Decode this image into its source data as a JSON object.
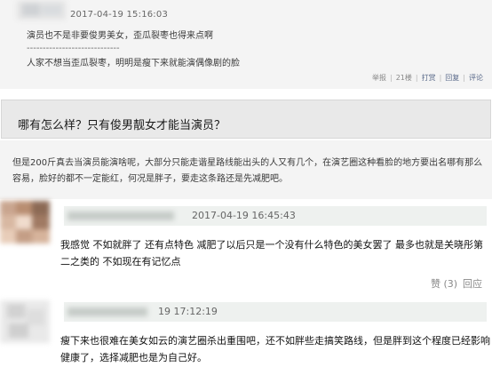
{
  "post1": {
    "timestamp": "2017-04-19 15:16:03",
    "lines": [
      "演员也不是非要俊男美女，歪瓜裂枣也得来点啊",
      "-----------------------------",
      "人家不想当歪瓜裂枣，明明是瘦下来就能演偶像剧的脸"
    ],
    "actions": {
      "report": "举报",
      "floor": "21楼",
      "reward": "打赏",
      "reply": "回复",
      "comment": "评论"
    }
  },
  "question": {
    "text": "哪有怎么样？只有俊男靓女才能当演员？"
  },
  "answer": {
    "text": "但是200斤真去当演员能演啥呢，大部分只能走谐星路线能出头的人又有几个，在演艺圈这种看脸的地方要出名哪有那么容易，脸好的都不一定能红，何况是胖子，要走这条路还是先减肥吧。"
  },
  "comments": [
    {
      "timestamp": "2017-04-19 16:45:43",
      "text": "我感觉 不如就胖了 还有点特色 减肥了以后只是一个没有什么特色的美女罢了 最多也就是关晓彤第二之类的 不如现在有记忆点",
      "like_label": "赞 (3)",
      "reply_label": "回应"
    },
    {
      "timestamp": "19 17:12:19",
      "text": "瘦下来也很难在美女如云的演艺圈杀出重围吧，还不如胖些走搞笑路线，但是胖到这个程度已经影响健康了，选择减肥也是为自己好。"
    }
  ],
  "colors": {
    "panel_bg": "#f4f4f4",
    "question_bg": "#e9e9e9",
    "comment_header_bg": "#eef1ef",
    "action_link": "#5a6a8a"
  }
}
